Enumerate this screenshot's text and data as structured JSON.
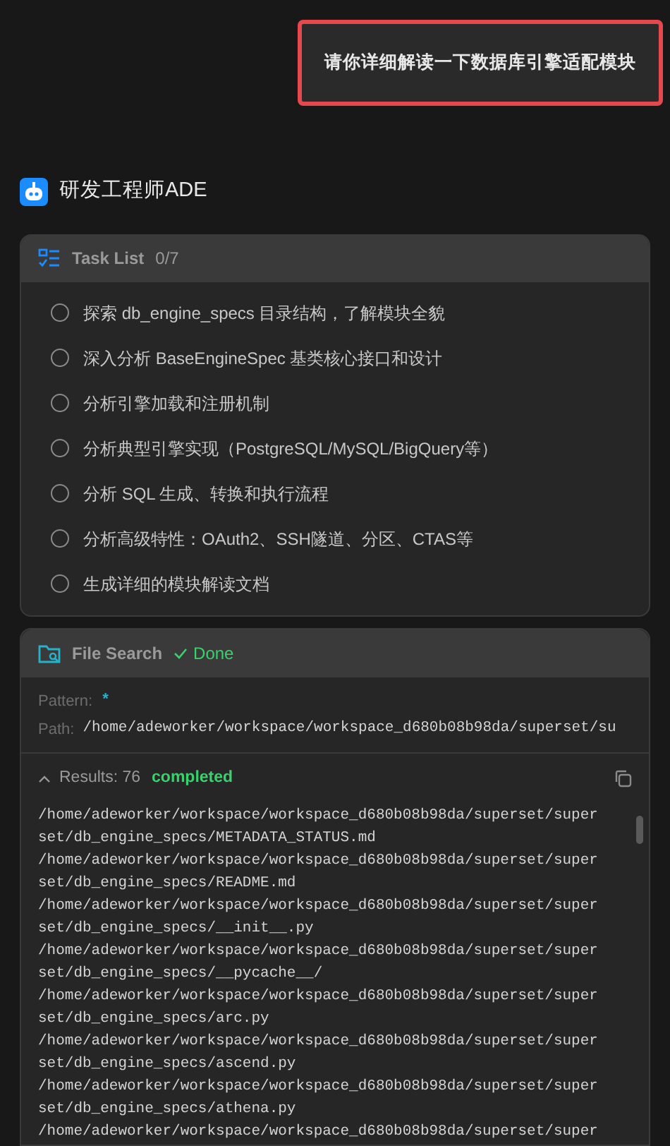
{
  "user_message": {
    "text": "请你详细解读一下数据库引擎适配模块",
    "highlighted": true
  },
  "agent": {
    "name": "研发工程师ADE"
  },
  "task_list": {
    "title": "Task List",
    "count": "0/7",
    "items": [
      {
        "text": "探索 db_engine_specs 目录结构，了解模块全貌",
        "checked": false
      },
      {
        "text": "深入分析 BaseEngineSpec 基类核心接口和设计",
        "checked": false
      },
      {
        "text": "分析引擎加载和注册机制",
        "checked": false
      },
      {
        "text": "分析典型引擎实现（PostgreSQL/MySQL/BigQuery等）",
        "checked": false
      },
      {
        "text": "分析 SQL 生成、转换和执行流程",
        "checked": false
      },
      {
        "text": "分析高级特性：OAuth2、SSH隧道、分区、CTAS等",
        "checked": false
      },
      {
        "text": "生成详细的模块解读文档",
        "checked": false
      }
    ]
  },
  "file_search": {
    "title": "File Search",
    "status": "Done",
    "done": true,
    "pattern_label": "Pattern:",
    "pattern": "*",
    "path_label": "Path:",
    "path": "/home/adeworker/workspace/workspace_d680b08b98da/superset/su",
    "results_label": "Results: 76",
    "results_status": "completed",
    "expanded": true,
    "results": [
      "/home/adeworker/workspace/workspace_d680b08b98da/superset/super",
      "set/db_engine_specs/METADATA_STATUS.md",
      "/home/adeworker/workspace/workspace_d680b08b98da/superset/super",
      "set/db_engine_specs/README.md",
      "/home/adeworker/workspace/workspace_d680b08b98da/superset/super",
      "set/db_engine_specs/__init__.py",
      "/home/adeworker/workspace/workspace_d680b08b98da/superset/super",
      "set/db_engine_specs/__pycache__/",
      "/home/adeworker/workspace/workspace_d680b08b98da/superset/super",
      "set/db_engine_specs/arc.py",
      "/home/adeworker/workspace/workspace_d680b08b98da/superset/super",
      "set/db_engine_specs/ascend.py",
      "/home/adeworker/workspace/workspace_d680b08b98da/superset/super",
      "set/db_engine_specs/athena.py",
      "/home/adeworker/workspace/workspace_d680b08b98da/superset/super"
    ]
  }
}
